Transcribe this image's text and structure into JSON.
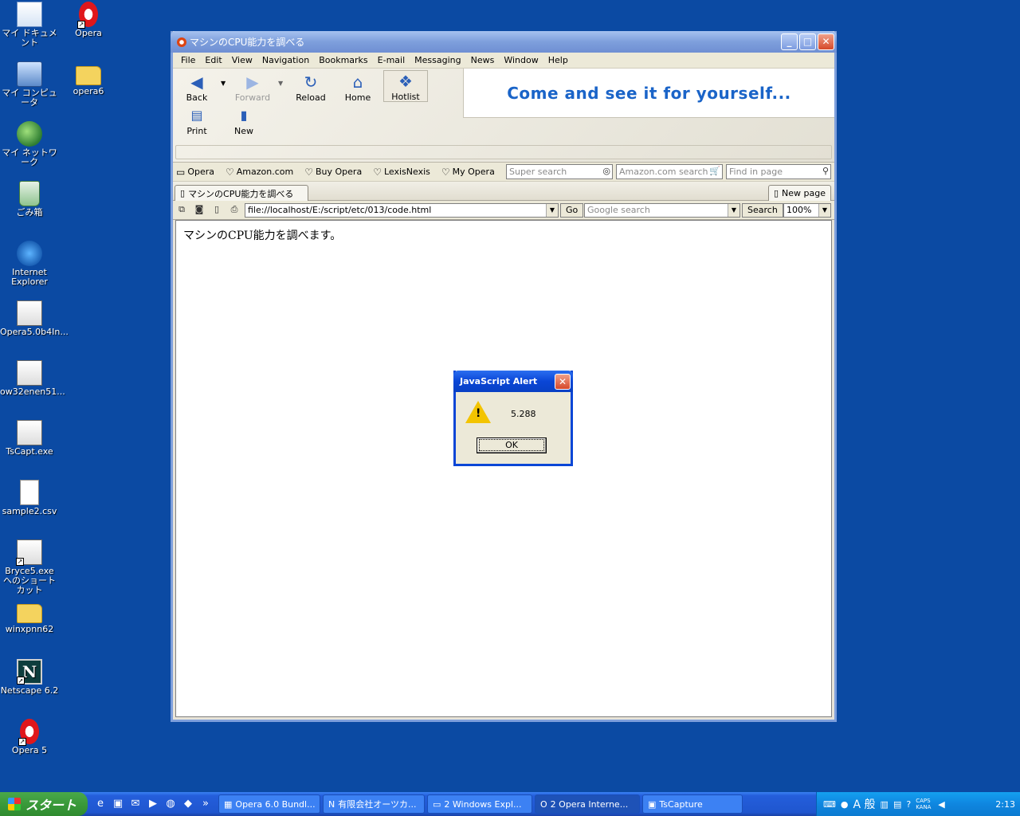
{
  "desktop": {
    "icons": [
      {
        "label": "マイ ドキュメント",
        "icon": "my-documents-icon"
      },
      {
        "label": "Opera",
        "icon": "opera-icon"
      },
      {
        "label": "マイ コンピュータ",
        "icon": "my-computer-icon"
      },
      {
        "label": "opera6",
        "icon": "folder-icon"
      },
      {
        "label": "マイ ネットワーク",
        "icon": "my-network-icon"
      },
      {
        "label": "ごみ箱",
        "icon": "recycle-bin-icon"
      },
      {
        "label": "Internet Explorer",
        "icon": "internet-explorer-icon"
      },
      {
        "label": "Opera5.0b4In...",
        "icon": "installer-icon"
      },
      {
        "label": "ow32enen51...",
        "icon": "installer-icon"
      },
      {
        "label": "TsCapt.exe",
        "icon": "app-icon"
      },
      {
        "label": "sample2.csv",
        "icon": "file-icon"
      },
      {
        "label": "Bryce5.exe へのショートカット",
        "icon": "app-icon"
      },
      {
        "label": "winxpnn62",
        "icon": "folder-icon"
      },
      {
        "label": "Netscape 6.2",
        "icon": "netscape-icon"
      },
      {
        "label": "Opera 5",
        "icon": "opera-icon"
      }
    ]
  },
  "window": {
    "title": "マシンのCPU能力を調べる",
    "menu": [
      "File",
      "Edit",
      "View",
      "Navigation",
      "Bookmarks",
      "E-mail",
      "Messaging",
      "News",
      "Window",
      "Help"
    ],
    "toolbar": {
      "back": "Back",
      "forward": "Forward",
      "reload": "Reload",
      "home": "Home",
      "hotlist": "Hotlist",
      "print": "Print",
      "new": "New"
    },
    "ad_text": "Come and see it for yourself...",
    "personal_bar": [
      "Opera",
      "Amazon.com",
      "Buy Opera",
      "LexisNexis",
      "My Opera"
    ],
    "search": {
      "super_placeholder": "Super search",
      "amazon_placeholder": "Amazon.com search",
      "find_placeholder": "Find in page"
    },
    "tab_title": "マシンのCPU能力を調べる",
    "new_page": "New page",
    "address": "file://localhost/E:/script/etc/013/code.html",
    "go": "Go",
    "google_placeholder": "Google search",
    "search_button": "Search",
    "zoom": "100%",
    "page_text": "マシンのCPU能力を調べます。"
  },
  "alert": {
    "title": "JavaScript Alert",
    "message": "5.288",
    "ok": "OK"
  },
  "taskbar": {
    "start": "スタート",
    "tasks": [
      "Opera 6.0 Bundl...",
      "有限会社オーツカ...",
      "2 Windows Expl...",
      "2 Opera Interne...",
      "TsCapture"
    ],
    "ime": "A 般",
    "caps": "CAPS KANA",
    "clock": "2:13"
  }
}
